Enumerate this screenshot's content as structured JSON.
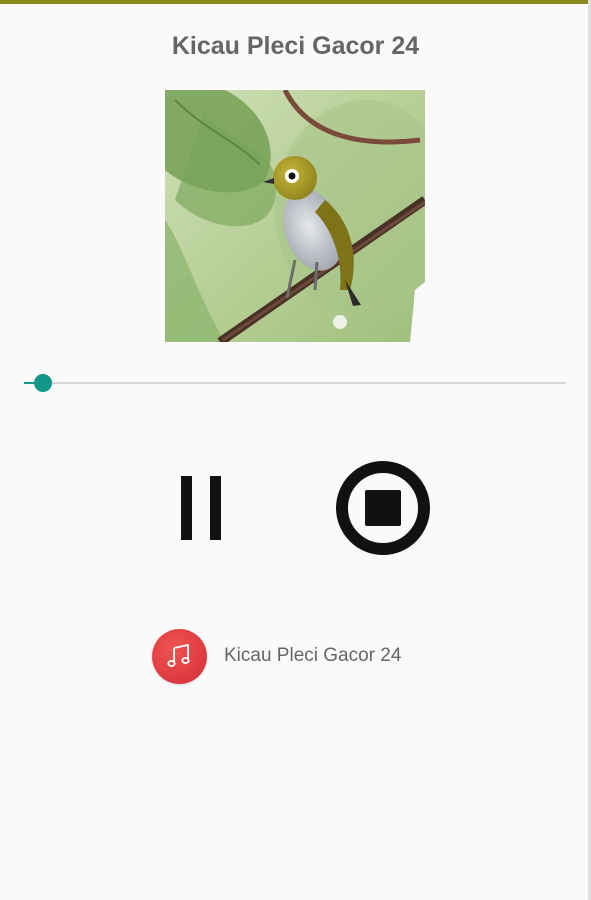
{
  "app": {
    "title": "Kicau Pleci Gacor 24"
  },
  "player": {
    "artwork_subject": "bird-on-branch-image",
    "progress_fraction": 0.035,
    "pause_icon": "pause-icon",
    "stop_icon": "stop-circle-icon"
  },
  "now_playing": {
    "icon": "music-note-icon",
    "track_title": "Kicau Pleci Gacor 24"
  },
  "colors": {
    "accent": "#129688",
    "top_bar": "#8a8a1e",
    "note_badge": "#e23c3c",
    "text_gray": "#666666",
    "control_black": "#111111"
  }
}
